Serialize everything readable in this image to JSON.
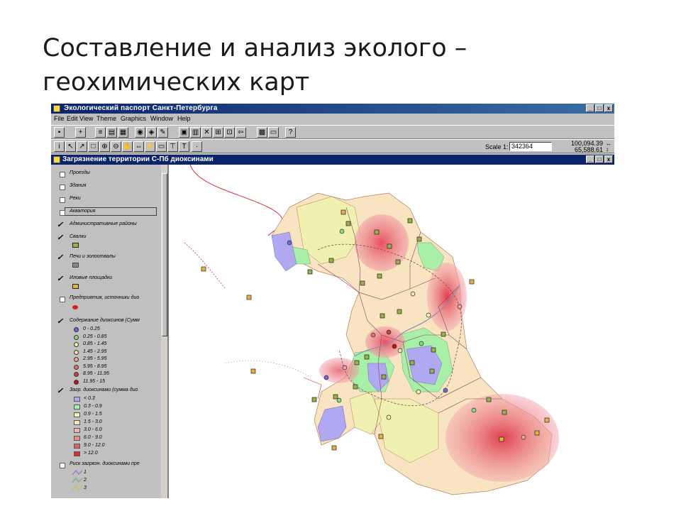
{
  "slide": {
    "title_line1": "Составление и анализ эколого –",
    "title_line2": "геохимических карт"
  },
  "app": {
    "window_title": "Экологический паспорт Санкт-Петербурга",
    "window_buttons": [
      "_",
      "□",
      "x"
    ],
    "menu": [
      "File",
      "Edit",
      "View",
      "Theme",
      "Graphics",
      "Window",
      "Help"
    ]
  },
  "toolbar": {
    "scale_label": "Scale 1:",
    "scale_value": "342364",
    "coord_x": "100,094.39",
    "coord_y": "65,588.61",
    "coord_arrows": "↔ ↕"
  },
  "view": {
    "title": "Загрязнение территории С-Пб диоксинами",
    "buttons": [
      "_",
      "□",
      "x"
    ]
  },
  "legend": {
    "layers": [
      {
        "label": "Проезды",
        "checked": false
      },
      {
        "label": "Здания",
        "checked": false
      },
      {
        "label": "Реки",
        "checked": false
      },
      {
        "label": "Акватория",
        "checked": false
      },
      {
        "label": "Административные районы",
        "checked": true
      },
      {
        "label": "Свалки",
        "checked": true
      },
      {
        "label": "Печи и золоотвалы",
        "checked": true
      },
      {
        "label": "Иловые площадки",
        "checked": true
      },
      {
        "label": "Предприятия, источники дио",
        "checked": false
      },
      {
        "label": "Содержание диоксинов (Сумм",
        "checked": true
      },
      {
        "label": "Загр. диоксинами (сумма дио",
        "checked": true
      },
      {
        "label": "Риск загрязн. диоксинами пре",
        "checked": false
      }
    ],
    "point_classes": [
      {
        "label": "0 - 0.25",
        "color": "#6b6bd8"
      },
      {
        "label": "0.25 - 0.85",
        "color": "#8ad88a"
      },
      {
        "label": "0.85 - 1.45",
        "color": "#f0f0a0"
      },
      {
        "label": "1.45 - 2.95",
        "color": "#f5e0b0"
      },
      {
        "label": "2.95 - 5.95",
        "color": "#f0a0a0"
      },
      {
        "label": "5.95 - 8.95",
        "color": "#e07070"
      },
      {
        "label": "8.95 - 11.95",
        "color": "#d04040"
      },
      {
        "label": "11.95 - 15",
        "color": "#c01010"
      }
    ],
    "zone_classes": [
      {
        "label": "< 0.3",
        "color": "#b0a8f0"
      },
      {
        "label": "0.3 - 0.9",
        "color": "#a8f0a8"
      },
      {
        "label": "0.9 - 1.5",
        "color": "#f0f0b0"
      },
      {
        "label": "1.5 - 3.0",
        "color": "#f8e4c0"
      },
      {
        "label": "3.0 - 6.0",
        "color": "#f4b0b0"
      },
      {
        "label": "6.0 - 9.0",
        "color": "#ec8a8a"
      },
      {
        "label": "9.0 - 12.0",
        "color": "#e06060"
      },
      {
        "label": "> 12.0",
        "color": "#d83030"
      }
    ],
    "risk_classes": [
      {
        "label": "1",
        "color": "#9b6bd0"
      },
      {
        "label": "2",
        "color": "#70b070"
      },
      {
        "label": "3",
        "color": "#c8c040"
      }
    ]
  }
}
